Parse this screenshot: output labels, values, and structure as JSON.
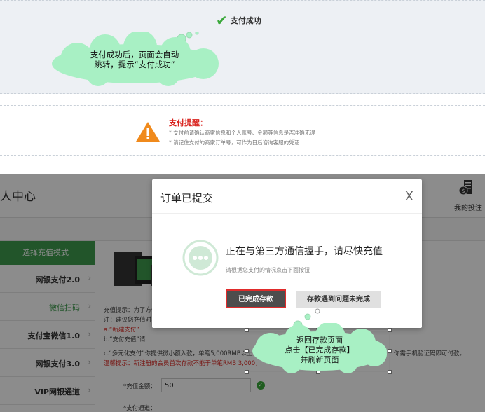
{
  "top": {
    "success_text": "支付成功",
    "annotation_line1": "支付成功后，页面会自动",
    "annotation_line2": "跳转，提示“支付成功”"
  },
  "notice": {
    "title": "支付提醒：",
    "line1": "* 支付前请确认商家信息和个人账号、金额等信息是否准确无误",
    "line2": "* 请记住支付的商家订单号，可作为日后咨询客服的凭证"
  },
  "app": {
    "title": "人中心",
    "header_icon_label": "我的投注",
    "sidebar": {
      "header": "选择充值模式",
      "items": [
        {
          "label": "网银支付2.0",
          "active": false
        },
        {
          "label": "微信扫码",
          "active": true
        },
        {
          "label": "支付宝微信1.0",
          "active": false
        },
        {
          "label": "网银支付3.0",
          "active": false
        },
        {
          "label": "VIP网银通道",
          "active": false
        }
      ]
    },
    "content": {
      "line1": "充值提示：为了方便",
      "line2": "注：建议您充值时要",
      "line3": "a.“新建支付”",
      "line4": "b.“支付充值”请",
      "line5": "c.“多元化支付”你提供微小额入款，单笔5,000RMB以上请联",
      "line5b": "你需手机验证码即可付款。",
      "line6": "温馨提示：新注册的会员首次存款不能于单笔RMB 3,000，",
      "amount_label": "*充值金额：",
      "amount_value": "50",
      "channel_label": "*支付通道："
    }
  },
  "modal": {
    "title": "订单已提交",
    "close": "X",
    "message": "正在与第三方通信握手，请尽快充值",
    "hint": "请根据您支付的情况点击下面按钮",
    "btn_done": "已完成存款",
    "btn_problem": "存款遇到问题未完成"
  },
  "annotation2": {
    "line1": "返回存款页面",
    "line2": "点击【已完成存款】",
    "line3": "并刷新页面"
  },
  "colors": {
    "cloud_fill": "#a8f0c4",
    "brand_green": "#3f9b4e",
    "alert_red": "#d9231e",
    "success_green": "#3aa83a"
  }
}
